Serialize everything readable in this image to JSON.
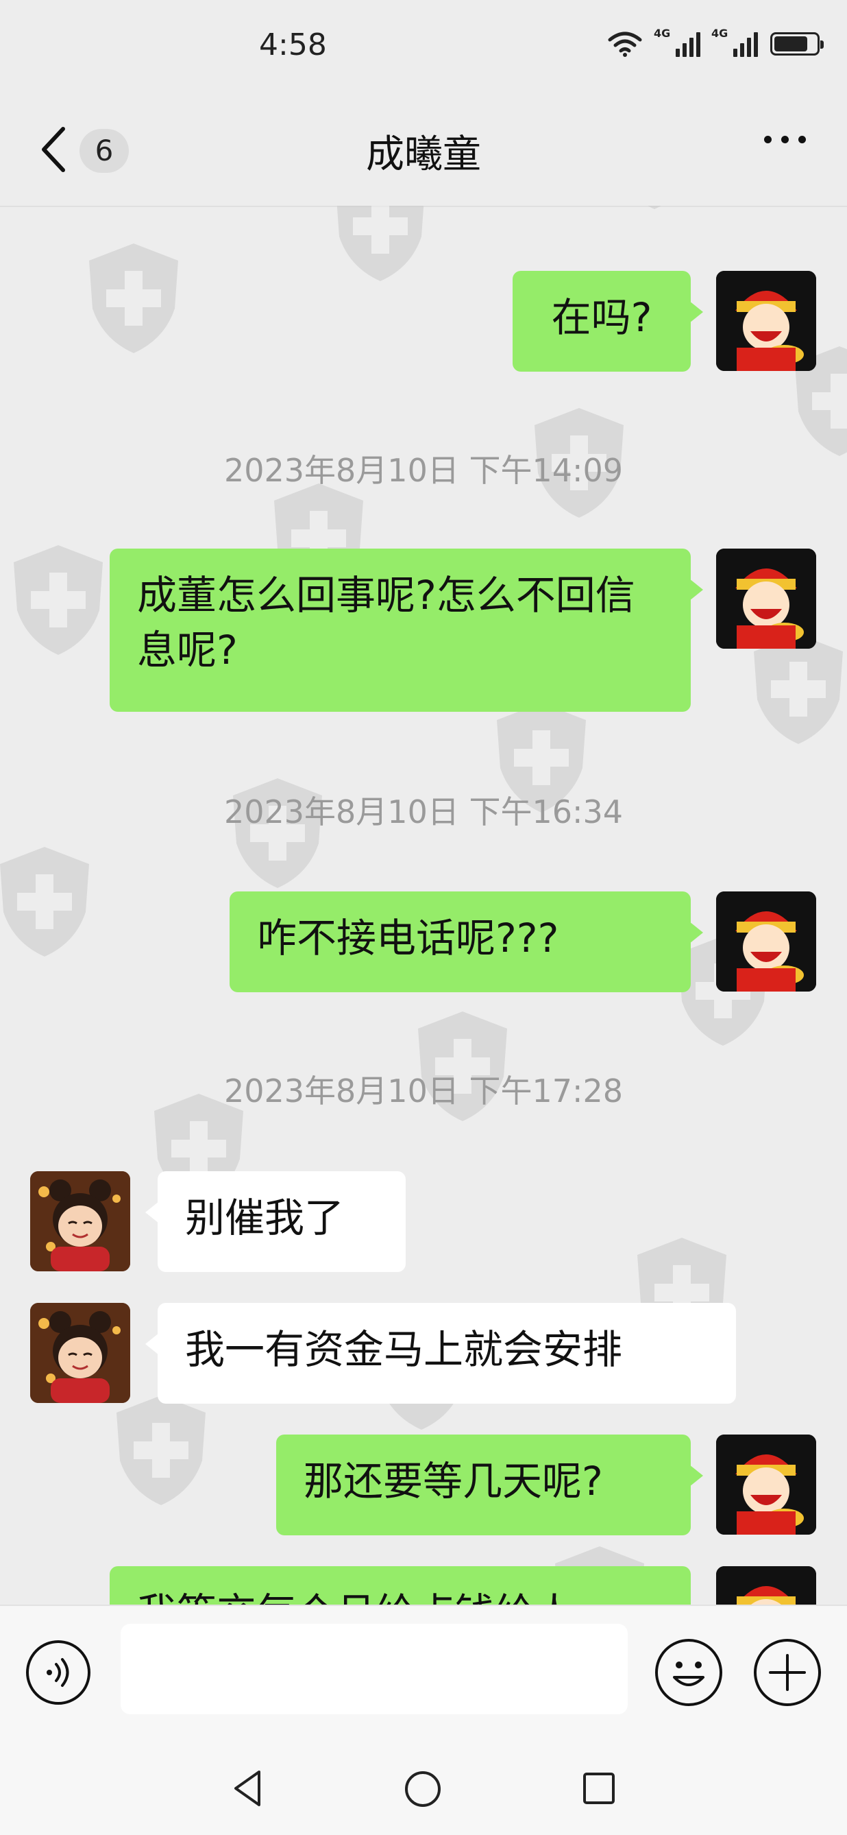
{
  "status_bar": {
    "time": "4:58",
    "network1": "4G",
    "network2": "4G",
    "battery_level": 0.8,
    "icons": [
      "wifi-icon",
      "signal-icon",
      "signal-icon",
      "battery-icon"
    ]
  },
  "title_bar": {
    "unread_count": "6",
    "contact_name": "成曦童",
    "icons": [
      "back-chevron-icon",
      "more-icon"
    ]
  },
  "timestamps": [
    "2023年8月10日 下午14:09",
    "2023年8月10日 下午16:34",
    "2023年8月10日 下午17:28"
  ],
  "messages": [
    {
      "sender": "me",
      "text": "在吗?"
    },
    {
      "sender": "me",
      "text": "成董怎么回事呢?怎么不回信息呢?"
    },
    {
      "sender": "me",
      "text": "咋不接电话呢???"
    },
    {
      "sender": "contact",
      "text": "别催我了"
    },
    {
      "sender": "contact",
      "text": "我一有资金马上就会安排"
    },
    {
      "sender": "me",
      "text": "那还要等几天呢?"
    },
    {
      "sender": "me",
      "text": "我等交每个月给点钱给人"
    }
  ],
  "input_bar": {
    "value": "",
    "icons": [
      "voice-icon",
      "emoji-icon",
      "plus-icon"
    ]
  },
  "nav_bar": {
    "icons": [
      "back-triangle-icon",
      "home-circle-icon",
      "recents-square-icon"
    ]
  },
  "colors": {
    "background": "#ededed",
    "outgoing_bubble": "#95ec69",
    "incoming_bubble": "#ffffff",
    "timestamp_text": "#9a9a9a"
  }
}
